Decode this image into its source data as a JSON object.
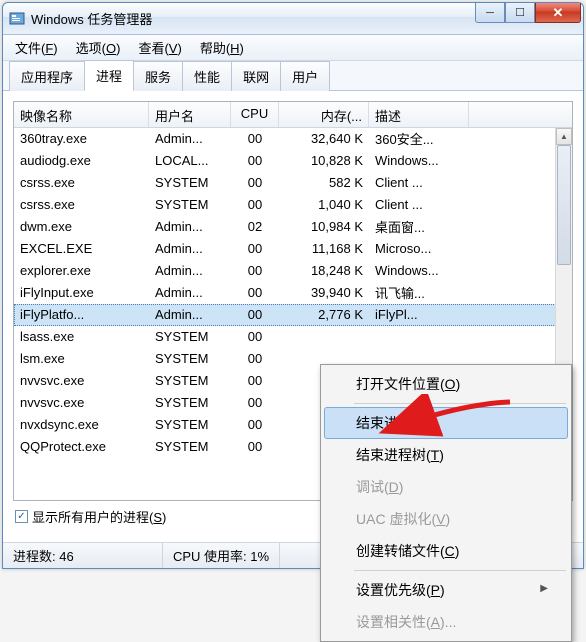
{
  "window": {
    "title": "Windows 任务管理器"
  },
  "menu": {
    "file": "文件(F)",
    "options": "选项(O)",
    "view": "查看(V)",
    "help": "帮助(H)"
  },
  "tabs": {
    "apps": "应用程序",
    "processes": "进程",
    "services": "服务",
    "performance": "性能",
    "networking": "联网",
    "users": "用户"
  },
  "columns": {
    "image": "映像名称",
    "user": "用户名",
    "cpu": "CPU",
    "mem": "内存(...",
    "desc": "描述"
  },
  "rows": [
    {
      "img": "360tray.exe",
      "user": "Admin...",
      "cpu": "00",
      "mem": "32,640 K",
      "desc": "360安全..."
    },
    {
      "img": "audiodg.exe",
      "user": "LOCAL...",
      "cpu": "00",
      "mem": "10,828 K",
      "desc": "Windows..."
    },
    {
      "img": "csrss.exe",
      "user": "SYSTEM",
      "cpu": "00",
      "mem": "582 K",
      "desc": "Client ..."
    },
    {
      "img": "csrss.exe",
      "user": "SYSTEM",
      "cpu": "00",
      "mem": "1,040 K",
      "desc": "Client ..."
    },
    {
      "img": "dwm.exe",
      "user": "Admin...",
      "cpu": "02",
      "mem": "10,984 K",
      "desc": "桌面窗..."
    },
    {
      "img": "EXCEL.EXE",
      "user": "Admin...",
      "cpu": "00",
      "mem": "11,168 K",
      "desc": "Microso..."
    },
    {
      "img": "explorer.exe",
      "user": "Admin...",
      "cpu": "00",
      "mem": "18,248 K",
      "desc": "Windows..."
    },
    {
      "img": "iFlyInput.exe",
      "user": "Admin...",
      "cpu": "00",
      "mem": "39,940 K",
      "desc": "讯飞输..."
    },
    {
      "img": "iFlyPlatfo...",
      "user": "Admin...",
      "cpu": "00",
      "mem": "2,776 K",
      "desc": "iFlyPl...",
      "sel": true
    },
    {
      "img": "lsass.exe",
      "user": "SYSTEM",
      "cpu": "00",
      "mem": "",
      "desc": ""
    },
    {
      "img": "lsm.exe",
      "user": "SYSTEM",
      "cpu": "00",
      "mem": "",
      "desc": ""
    },
    {
      "img": "nvvsvc.exe",
      "user": "SYSTEM",
      "cpu": "00",
      "mem": "",
      "desc": ""
    },
    {
      "img": "nvvsvc.exe",
      "user": "SYSTEM",
      "cpu": "00",
      "mem": "",
      "desc": ""
    },
    {
      "img": "nvxdsync.exe",
      "user": "SYSTEM",
      "cpu": "00",
      "mem": "",
      "desc": ""
    },
    {
      "img": "QQProtect.exe",
      "user": "SYSTEM",
      "cpu": "00",
      "mem": "",
      "desc": ""
    }
  ],
  "checkbox": {
    "label": "显示所有用户的进程(S)"
  },
  "status": {
    "procs": "进程数: 46",
    "cpu": "CPU 使用率: 1%"
  },
  "context": {
    "open_location": "打开文件位置(O)",
    "end_process": "结束进程(E)",
    "end_tree": "结束进程树(T)",
    "debug": "调试(D)",
    "uac": "UAC 虚拟化(V)",
    "dump": "创建转储文件(C)",
    "priority": "设置优先级(P)",
    "affinity": "设置相关性(A)..."
  }
}
